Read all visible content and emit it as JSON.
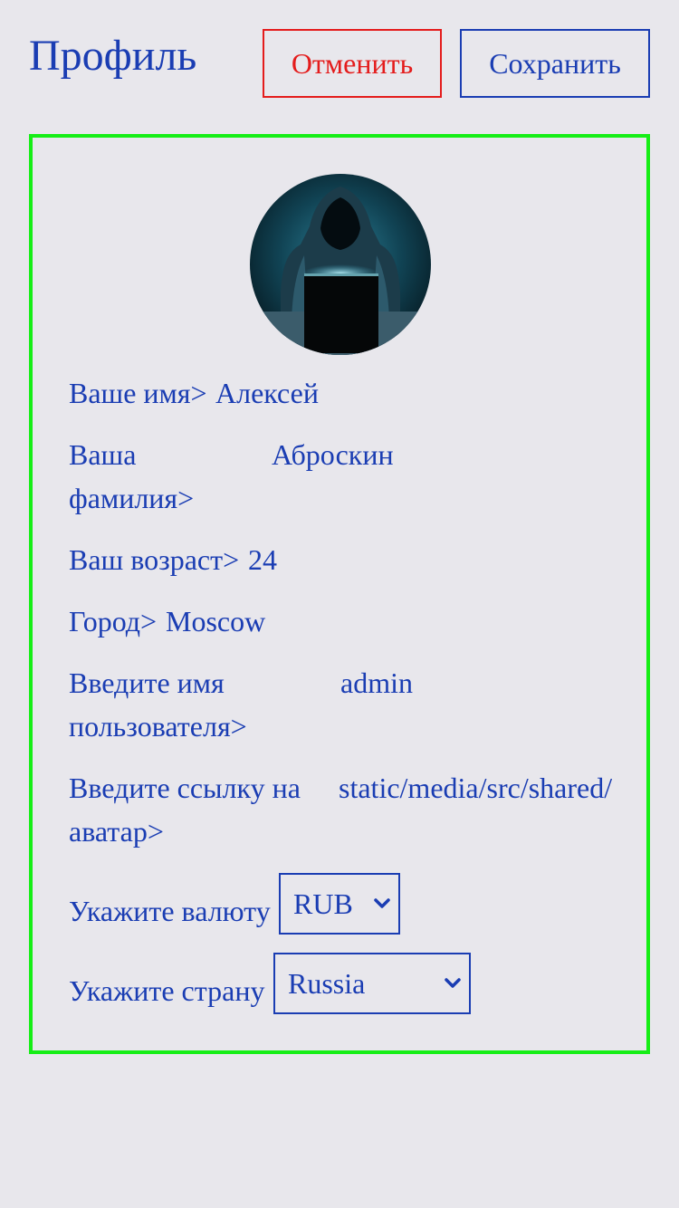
{
  "header": {
    "title": "Профиль",
    "cancel_label": "Отменить",
    "save_label": "Сохранить"
  },
  "profile": {
    "name_label": "Ваше имя>",
    "name_value": "Алексей",
    "surname_label_line1": "Ваша",
    "surname_label_line2": "фамилия>",
    "surname_value": "Аброскин",
    "age_label": "Ваш возраст>",
    "age_value": "24",
    "city_label": "Город>",
    "city_value": "Moscow",
    "username_label_line1": "Введите имя",
    "username_label_line2": "пользователя>",
    "username_value": "admin",
    "avatar_label_line1": "Введите ссылку на",
    "avatar_label_line2": "аватар>",
    "avatar_value": "static/media/src/shared/",
    "currency_label": "Укажите валюту",
    "currency_value": "RUB",
    "country_label": "Укажите страну",
    "country_value": "Russia"
  },
  "colors": {
    "text_primary": "#1a3db3",
    "cancel": "#e41c1c",
    "card_border": "#16ee16",
    "background": "#e8e7ec"
  },
  "icons": {
    "avatar": "hooded-hacker-avatar",
    "select_chevron": "chevron-down-icon"
  }
}
